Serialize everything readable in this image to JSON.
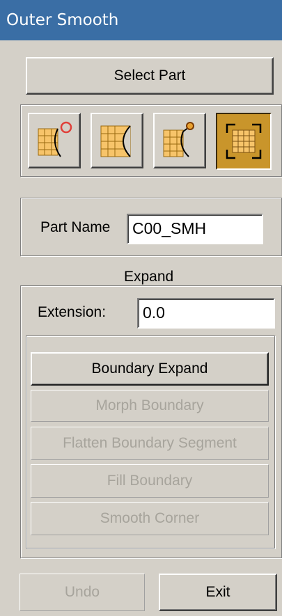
{
  "window": {
    "title": "Outer Smooth"
  },
  "select_part": {
    "label": "Select Part"
  },
  "modes": [
    {
      "icon": "grid-curve-circle-icon",
      "active": false
    },
    {
      "icon": "grid-concave-curve-icon",
      "active": false
    },
    {
      "icon": "grid-curve-knob-icon",
      "active": false
    },
    {
      "icon": "grid-full-frame-icon",
      "active": true
    }
  ],
  "part": {
    "label": "Part Name",
    "value": "C00_SMH"
  },
  "expand": {
    "title": "Expand",
    "extension_label": "Extension:",
    "extension_value": "0.0",
    "buttons": [
      {
        "label": "Boundary Expand",
        "enabled": true
      },
      {
        "label": "Morph Boundary",
        "enabled": false
      },
      {
        "label": "Flatten Boundary Segment",
        "enabled": false
      },
      {
        "label": "Fill Boundary",
        "enabled": false
      },
      {
        "label": "Smooth Corner",
        "enabled": false
      }
    ]
  },
  "footer": {
    "undo_label": "Undo",
    "exit_label": "Exit"
  },
  "colors": {
    "title_bar": "#3a6ea5",
    "dialog_bg": "#d4d0c8",
    "grid_fill": "#f7c46a",
    "active_mode": "#c9952b",
    "marker_red": "#e0403a"
  }
}
